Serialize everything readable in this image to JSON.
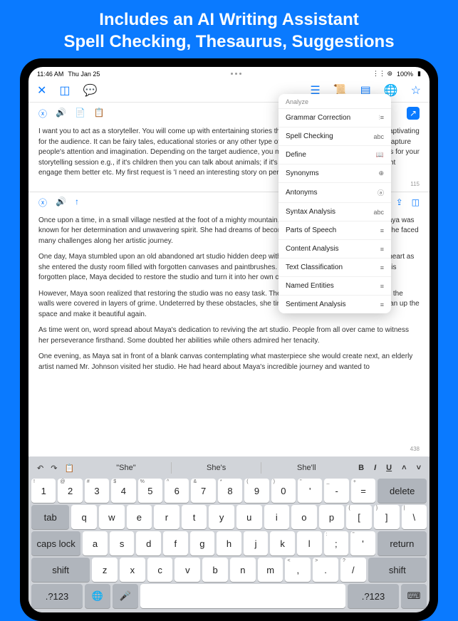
{
  "headline": {
    "line1": "Includes an AI Writing Assistant",
    "line2": "Spell Checking, Thesaurus, Suggestions"
  },
  "statusbar": {
    "time": "11:46 AM",
    "date": "Thu Jan 25",
    "battery": "100%"
  },
  "toolbar": {
    "close": "✕"
  },
  "panes": {
    "prompt_count": "115",
    "output_count": "438",
    "prompt": "I want you to act as a storyteller. You will come up with entertaining stories that are engaging, imaginative and captivating for the audience. It can be fairy tales, educational stories or any other type of stories which has the potential to capture people's attention and imagination. Depending on the target audience, you may choose specific themes or topics for your storytelling session e.g., if it's children then you can talk about animals; if it's adults then history-based tales might engage them better etc. My first request is 'I need an interesting story on perseverance.'",
    "p1": "Once upon a time, in a small village nestled at the foot of a mighty mountain, lived a young girl named Maya. Maya was known for her determination and unwavering spirit. She had dreams of becoming an accomplished painter, but she faced many challenges along her artistic journey.",
    "p2": "One day, Maya stumbled upon an old abandoned art studio hidden deep within the forest. Excitement filled her heart as she entered the dusty room filled with forgotten canvases and paintbrushes. Determined to bring life back into this forgotten place, Maya decided to restore the studio and turn it into her own creative sanctuary.",
    "p3": "However, Maya soon realized that restoring the studio was no easy task. The roof leaked during rainstorms, and the walls were covered in layers of grime. Undeterred by these obstacles, she tirelessly worked day and night to clean up the space and make it beautiful again.",
    "p4": "As time went on, word spread about Maya's dedication to reviving the art studio. People from all over came to witness her perseverance firsthand. Some doubted her abilities while others admired her tenacity.",
    "p5": "One evening, as Maya sat in front of a blank canvas contemplating what masterpiece she would create next, an elderly artist named Mr. Johnson visited her studio. He had heard about Maya's incredible journey and wanted to"
  },
  "popover": {
    "header": "Analyze",
    "items": [
      {
        "label": "Grammar Correction",
        "badge": "⫶≡"
      },
      {
        "label": "Spell Checking",
        "badge": "abc"
      },
      {
        "label": "Define",
        "badge": "📖"
      },
      {
        "label": "Synonyms",
        "badge": "⊕"
      },
      {
        "label": "Antonyms",
        "badge": "ⓐ"
      },
      {
        "label": "Syntax Analysis",
        "badge": "abc"
      },
      {
        "label": "Parts of Speech",
        "badge": "≡"
      },
      {
        "label": "Content Analysis",
        "badge": "≡"
      },
      {
        "label": "Text Classification",
        "badge": "≡"
      },
      {
        "label": "Named Entities",
        "badge": "≡"
      },
      {
        "label": "Sentiment Analysis",
        "badge": "≡"
      }
    ]
  },
  "keyboard": {
    "suggestions": [
      "\"She\"",
      "She's",
      "She'll"
    ],
    "fmt": {
      "b": "B",
      "i": "I",
      "u": "U"
    },
    "row_num_sub": [
      "!",
      "@",
      "#",
      "$",
      "%",
      "^",
      "&",
      "*",
      "(",
      ")",
      "\"",
      "_",
      "+"
    ],
    "row_num": [
      "1",
      "2",
      "3",
      "4",
      "5",
      "6",
      "7",
      "8",
      "9",
      "0",
      "'",
      "-",
      "="
    ],
    "row_q": [
      "q",
      "w",
      "e",
      "r",
      "t",
      "y",
      "u",
      "i",
      "o",
      "p",
      "[",
      "]",
      "\\"
    ],
    "row_q_sub": [
      "",
      "",
      "",
      "",
      "",
      "",
      "",
      "",
      "",
      "",
      "{",
      "}",
      "|"
    ],
    "row_a": [
      "a",
      "s",
      "d",
      "f",
      "g",
      "h",
      "j",
      "k",
      "l",
      ";",
      "'"
    ],
    "row_a_sub": [
      "",
      "",
      "",
      "",
      "",
      "",
      "",
      "",
      "",
      ":",
      "\""
    ],
    "row_z": [
      "z",
      "x",
      "c",
      "v",
      "b",
      "n",
      "m",
      ",",
      ".",
      "/"
    ],
    "row_z_sub": [
      "",
      "",
      "",
      "",
      "",
      "",
      "",
      "<",
      ">",
      "?"
    ],
    "delete": "delete",
    "tab": "tab",
    "caps": "caps lock",
    "return": "return",
    "shift": "shift",
    "sym": ".?123"
  }
}
